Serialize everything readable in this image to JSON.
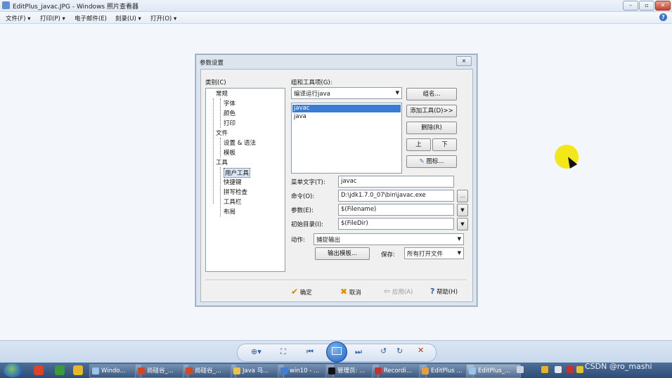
{
  "window": {
    "title": "EditPlus_javac.JPG - Windows 照片查看器",
    "controls": [
      "–",
      "▫",
      "✕"
    ]
  },
  "menu": {
    "items": [
      {
        "label": "文件(F)"
      },
      {
        "label": "打印(P)"
      },
      {
        "label": "电子邮件(E)"
      },
      {
        "label": "刻录(U)"
      },
      {
        "label": "打开(O)"
      }
    ],
    "help": "?"
  },
  "dialog": {
    "title": "参数设置",
    "close": "×",
    "category_label": "类别(C)",
    "tree": [
      {
        "label": "常规",
        "level": 0
      },
      {
        "label": "字体",
        "level": 1
      },
      {
        "label": "颜色",
        "level": 1
      },
      {
        "label": "打印",
        "level": 1
      },
      {
        "label": "文件",
        "level": 0
      },
      {
        "label": "设置 & 语法",
        "level": 1
      },
      {
        "label": "模板",
        "level": 1
      },
      {
        "label": "工具",
        "level": 0
      },
      {
        "label": "用户工具",
        "level": 1,
        "selected": true
      },
      {
        "label": "快捷键",
        "level": 1
      },
      {
        "label": "拼写检查",
        "level": 1
      },
      {
        "label": "工具栏",
        "level": 1
      },
      {
        "label": "布局",
        "level": 1
      }
    ],
    "group_label": "组和工具项(G):",
    "group_value": "编译运行java",
    "tool_list": [
      {
        "label": "javac",
        "selected": true
      },
      {
        "label": "java",
        "selected": false
      }
    ],
    "buttons": {
      "rename": "组名...",
      "add_tool": "添加工具(D)>>",
      "delete": "删除(R)",
      "up": "上",
      "down": "下",
      "icon": "图标..."
    },
    "fields": {
      "menu_text_label": "菜单文字(T):",
      "menu_text_value": "javac",
      "command_label": "命令(O):",
      "command_value": "D:\\jdk1.7.0_07\\bin\\javac.exe",
      "browse": "...",
      "args_label": "参数(E):",
      "args_value": "$(Filename)",
      "initdir_label": "初始目录(I):",
      "initdir_value": "$(FileDir)"
    },
    "action_label": "动作:",
    "action_value": "捕捉输出",
    "output_pattern": "输出模板...",
    "save_label": "保存:",
    "save_value": "所有打开文件",
    "footer": {
      "ok": "确定",
      "cancel": "取消",
      "apply": "应用(A)",
      "help": "帮助(H)"
    }
  },
  "taskbar": {
    "tasks": [
      {
        "label": "Windo..."
      },
      {
        "label": "尚硅谷_..."
      },
      {
        "label": "尚硅谷_..."
      },
      {
        "label": "Java 马..."
      },
      {
        "label": "win10 - ..."
      },
      {
        "label": "管理员: ..."
      },
      {
        "label": "Recordi..."
      },
      {
        "label": "EditPlus ..."
      },
      {
        "label": "EditPlus_..."
      }
    ],
    "watermark": "CSDN @ro_mashi"
  },
  "colors": {
    "accent": "#3a7bd5",
    "highlight": "#f1e500"
  }
}
